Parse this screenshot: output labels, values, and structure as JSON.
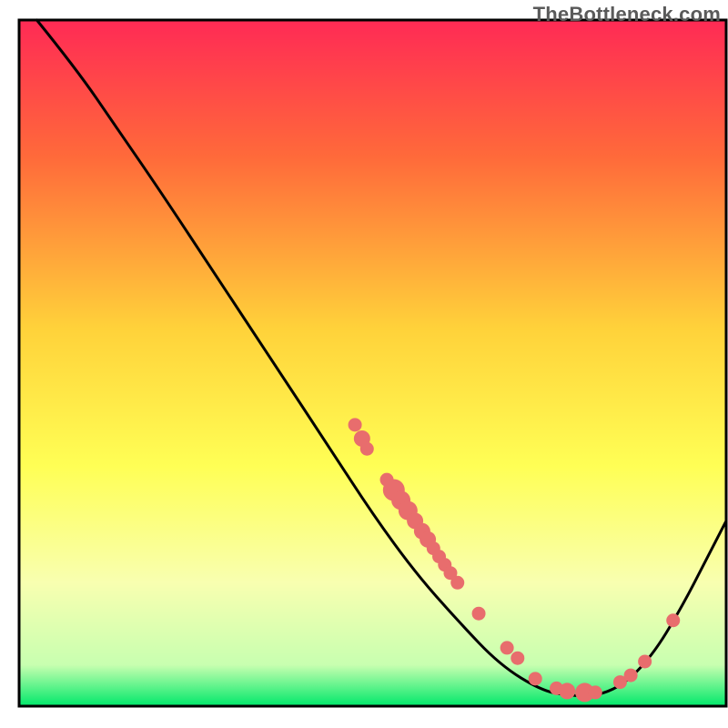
{
  "watermark": "TheBottleneck.com",
  "chart_data": {
    "type": "line",
    "title": "",
    "xlabel": "",
    "ylabel": "",
    "xlim": [
      0,
      100
    ],
    "ylim": [
      0,
      100
    ],
    "gradient_stops": [
      {
        "offset": 0,
        "color": "#ff2a55"
      },
      {
        "offset": 20,
        "color": "#ff6a3a"
      },
      {
        "offset": 45,
        "color": "#ffd23a"
      },
      {
        "offset": 65,
        "color": "#ffff55"
      },
      {
        "offset": 82,
        "color": "#f8ffb0"
      },
      {
        "offset": 94,
        "color": "#c8ffb0"
      },
      {
        "offset": 100,
        "color": "#00e86a"
      }
    ],
    "curve": [
      {
        "x": 2.5,
        "y": 100
      },
      {
        "x": 8,
        "y": 93
      },
      {
        "x": 14,
        "y": 84
      },
      {
        "x": 20,
        "y": 75
      },
      {
        "x": 28,
        "y": 62.5
      },
      {
        "x": 36,
        "y": 50
      },
      {
        "x": 44,
        "y": 37.5
      },
      {
        "x": 50,
        "y": 28
      },
      {
        "x": 56,
        "y": 19.5
      },
      {
        "x": 62,
        "y": 12.5
      },
      {
        "x": 68,
        "y": 6
      },
      {
        "x": 74,
        "y": 2.2
      },
      {
        "x": 78,
        "y": 1.5
      },
      {
        "x": 82,
        "y": 1.5
      },
      {
        "x": 86,
        "y": 3.5
      },
      {
        "x": 90,
        "y": 8
      },
      {
        "x": 94,
        "y": 15
      },
      {
        "x": 97,
        "y": 21
      },
      {
        "x": 100,
        "y": 27
      }
    ],
    "points": [
      {
        "x": 47.5,
        "y": 41,
        "r": 1.0
      },
      {
        "x": 48.5,
        "y": 39,
        "r": 1.2
      },
      {
        "x": 49.2,
        "y": 37.5,
        "r": 1.0
      },
      {
        "x": 52.0,
        "y": 33.0,
        "r": 1.0
      },
      {
        "x": 53.0,
        "y": 31.5,
        "r": 1.6
      },
      {
        "x": 54.0,
        "y": 30.0,
        "r": 1.4
      },
      {
        "x": 55.0,
        "y": 28.5,
        "r": 1.4
      },
      {
        "x": 56.0,
        "y": 27.0,
        "r": 1.2
      },
      {
        "x": 57.0,
        "y": 25.5,
        "r": 1.2
      },
      {
        "x": 57.8,
        "y": 24.3,
        "r": 1.2
      },
      {
        "x": 58.6,
        "y": 23.0,
        "r": 1.0
      },
      {
        "x": 59.4,
        "y": 21.8,
        "r": 1.0
      },
      {
        "x": 60.2,
        "y": 20.6,
        "r": 1.0
      },
      {
        "x": 61.0,
        "y": 19.4,
        "r": 1.0
      },
      {
        "x": 62.0,
        "y": 18.0,
        "r": 1.0
      },
      {
        "x": 65.0,
        "y": 13.5,
        "r": 1.0
      },
      {
        "x": 69.0,
        "y": 8.5,
        "r": 1.0
      },
      {
        "x": 70.5,
        "y": 7.0,
        "r": 1.0
      },
      {
        "x": 73.0,
        "y": 4.0,
        "r": 1.0
      },
      {
        "x": 76.0,
        "y": 2.6,
        "r": 1.0
      },
      {
        "x": 77.5,
        "y": 2.2,
        "r": 1.2
      },
      {
        "x": 80.0,
        "y": 2.0,
        "r": 1.4
      },
      {
        "x": 81.5,
        "y": 2.0,
        "r": 1.0
      },
      {
        "x": 85.0,
        "y": 3.5,
        "r": 1.0
      },
      {
        "x": 86.5,
        "y": 4.5,
        "r": 1.0
      },
      {
        "x": 88.5,
        "y": 6.5,
        "r": 1.0
      },
      {
        "x": 92.5,
        "y": 12.5,
        "r": 1.0
      }
    ],
    "point_color": "#e86d6d",
    "curve_color": "#000000",
    "border_color": "#000000"
  }
}
